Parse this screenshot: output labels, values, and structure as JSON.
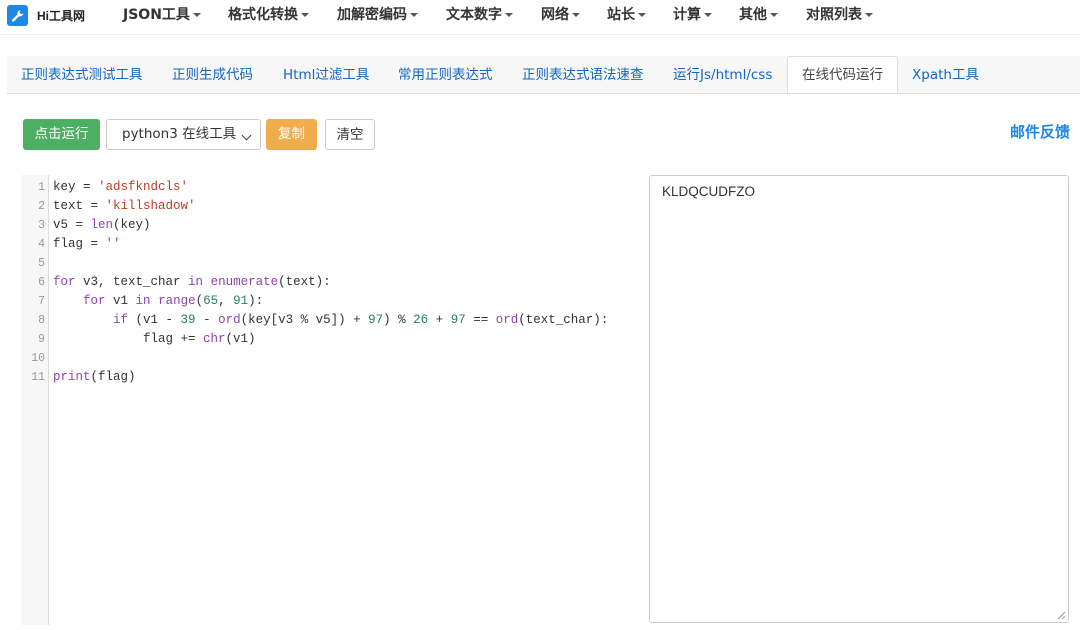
{
  "brand": {
    "name": "Hi工具网",
    "logo_icon": "wrench-icon",
    "color": "#1e88e5"
  },
  "nav": [
    {
      "label": "JSON工具"
    },
    {
      "label": "格式化转换"
    },
    {
      "label": "加解密编码"
    },
    {
      "label": "文本数字"
    },
    {
      "label": "网络"
    },
    {
      "label": "站长"
    },
    {
      "label": "计算"
    },
    {
      "label": "其他"
    },
    {
      "label": "对照列表"
    }
  ],
  "tabs": [
    {
      "label": "正则表达式测试工具"
    },
    {
      "label": "正则生成代码"
    },
    {
      "label": "Html过滤工具"
    },
    {
      "label": "常用正则表达式"
    },
    {
      "label": "正则表达式语法速查"
    },
    {
      "label": "运行Js/html/css"
    },
    {
      "label": "在线代码运行",
      "active": true
    },
    {
      "label": "Xpath工具"
    }
  ],
  "toolbar": {
    "run_label": "点击运行",
    "language_selected": "python3 在线工具",
    "copy_label": "复制",
    "clear_label": "清空",
    "feedback_label": "邮件反馈"
  },
  "editor": {
    "line_numbers": [
      "1",
      "2",
      "3",
      "4",
      "5",
      "6",
      "7",
      "8",
      "9",
      "10",
      "11"
    ]
  },
  "output": {
    "text": "KLDQCUDFZO"
  },
  "colors": {
    "run": "#4caf63",
    "copy": "#f0ad4e",
    "link": "#1565c0"
  }
}
